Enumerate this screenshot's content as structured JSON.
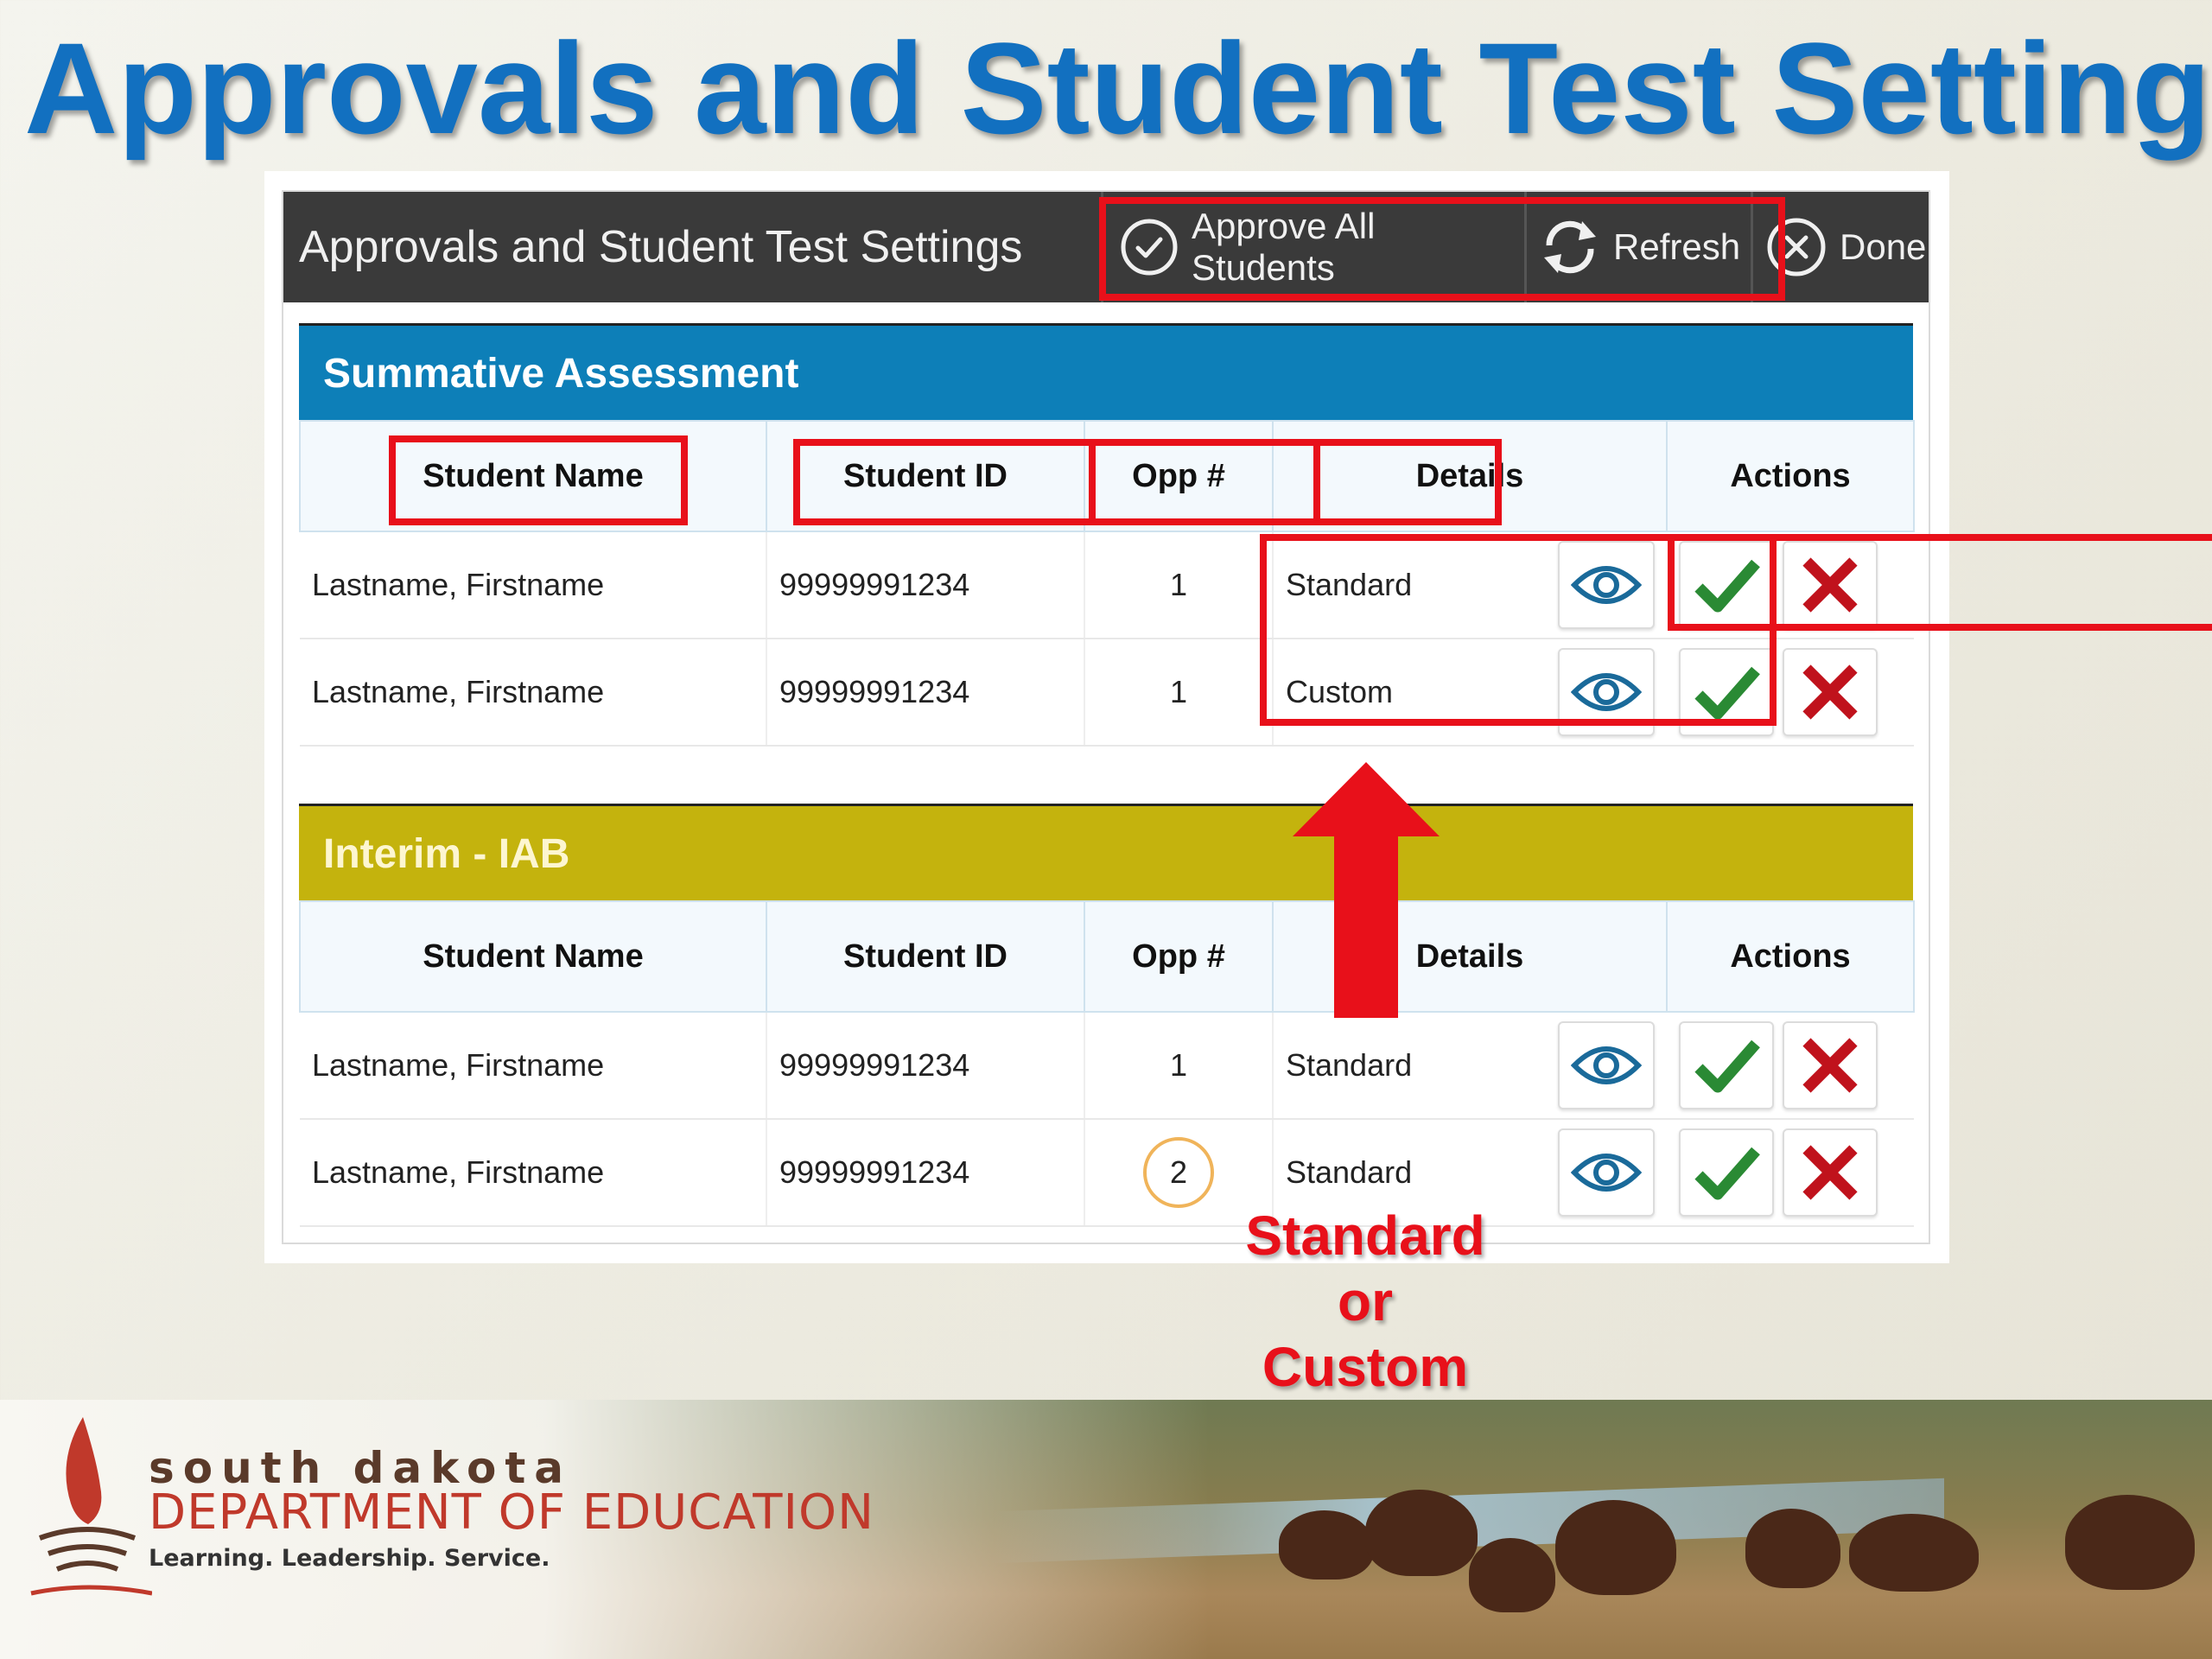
{
  "slide_title": "Approvals and Student Test Settings",
  "header": {
    "title": "Approvals and Student Test Settings",
    "approve_all": "Approve All Students",
    "refresh": "Refresh",
    "done": "Done"
  },
  "sections": [
    {
      "name": "Summative Assessment",
      "columns": [
        "Student Name",
        "Student ID",
        "Opp #",
        "Details",
        "Actions"
      ],
      "rows": [
        {
          "name": "Lastname, Firstname",
          "id": "99999991234",
          "opp": "1",
          "details": "Standard"
        },
        {
          "name": "Lastname, Firstname",
          "id": "99999991234",
          "opp": "1",
          "details": "Custom"
        }
      ]
    },
    {
      "name": "Interim - IAB",
      "columns": [
        "Student Name",
        "Student ID",
        "Opp #",
        "Details",
        "Actions"
      ],
      "rows": [
        {
          "name": "Lastname, Firstname",
          "id": "99999991234",
          "opp": "1",
          "details": "Standard"
        },
        {
          "name": "Lastname, Firstname",
          "id": "99999991234",
          "opp": "2",
          "details": "Standard"
        }
      ]
    }
  ],
  "annotation": {
    "line1": "Standard",
    "line2": "or",
    "line3": "Custom"
  },
  "footer": {
    "org_line1": "south dakota",
    "org_line2": "DEPARTMENT OF EDUCATION",
    "tagline": "Learning. Leadership. Service."
  },
  "colors": {
    "title_blue": "#1270c0",
    "summative_bar": "#0d7fb8",
    "interim_bar": "#c4b30d",
    "highlight_red": "#e8101a",
    "approve_green": "#2a8a34",
    "deny_red": "#c0121c",
    "eye_blue": "#1a6a9a"
  },
  "icons": {
    "approve_all": "check-circle-icon",
    "refresh": "refresh-icon",
    "done": "close-circle-icon",
    "details": "eye-icon",
    "approve": "checkmark-icon",
    "deny": "x-icon"
  }
}
